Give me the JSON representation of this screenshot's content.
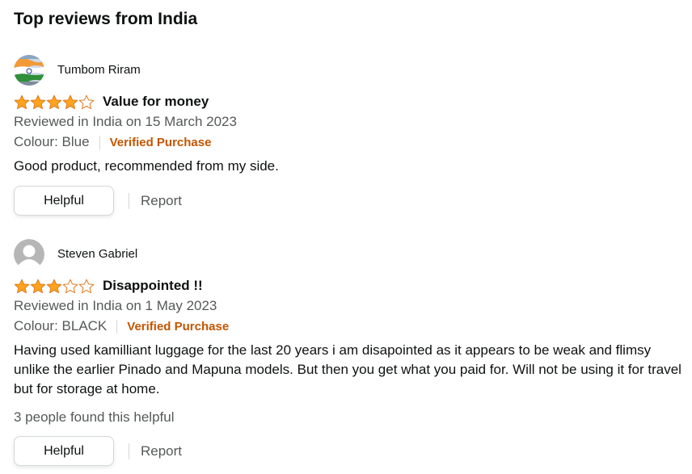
{
  "section": {
    "title": "Top reviews from India"
  },
  "colors": {
    "star": "#ffa41c",
    "verified": "#c45500",
    "muted_text": "#565959"
  },
  "reviews": [
    {
      "profile_name": "Tumbom Riram",
      "avatar_icon": "india-flag-avatar-icon",
      "rating": 4,
      "max_rating": 5,
      "title": "Value for money",
      "date": "Reviewed in India on 15 March 2023",
      "colour": "Colour: Blue",
      "verified": "Verified Purchase",
      "body": "Good product, recommended from my side.",
      "helpful_count": "",
      "helpful_label": "Helpful",
      "report_label": "Report"
    },
    {
      "profile_name": "Steven Gabriel",
      "avatar_icon": "default-user-avatar-icon",
      "rating": 3,
      "max_rating": 5,
      "title": "Disappointed !!",
      "date": "Reviewed in India on 1 May 2023",
      "colour": "Colour: BLACK",
      "verified": "Verified Purchase",
      "body": "Having used kamilliant luggage for the last 20 years i am disapointed as it appears to be weak and flimsy unlike the earlier Pinado and Mapuna models. But then you get what you paid for. Will not be using it for travel but for storage at home.",
      "helpful_count": "3 people found this helpful",
      "helpful_label": "Helpful",
      "report_label": "Report"
    }
  ]
}
